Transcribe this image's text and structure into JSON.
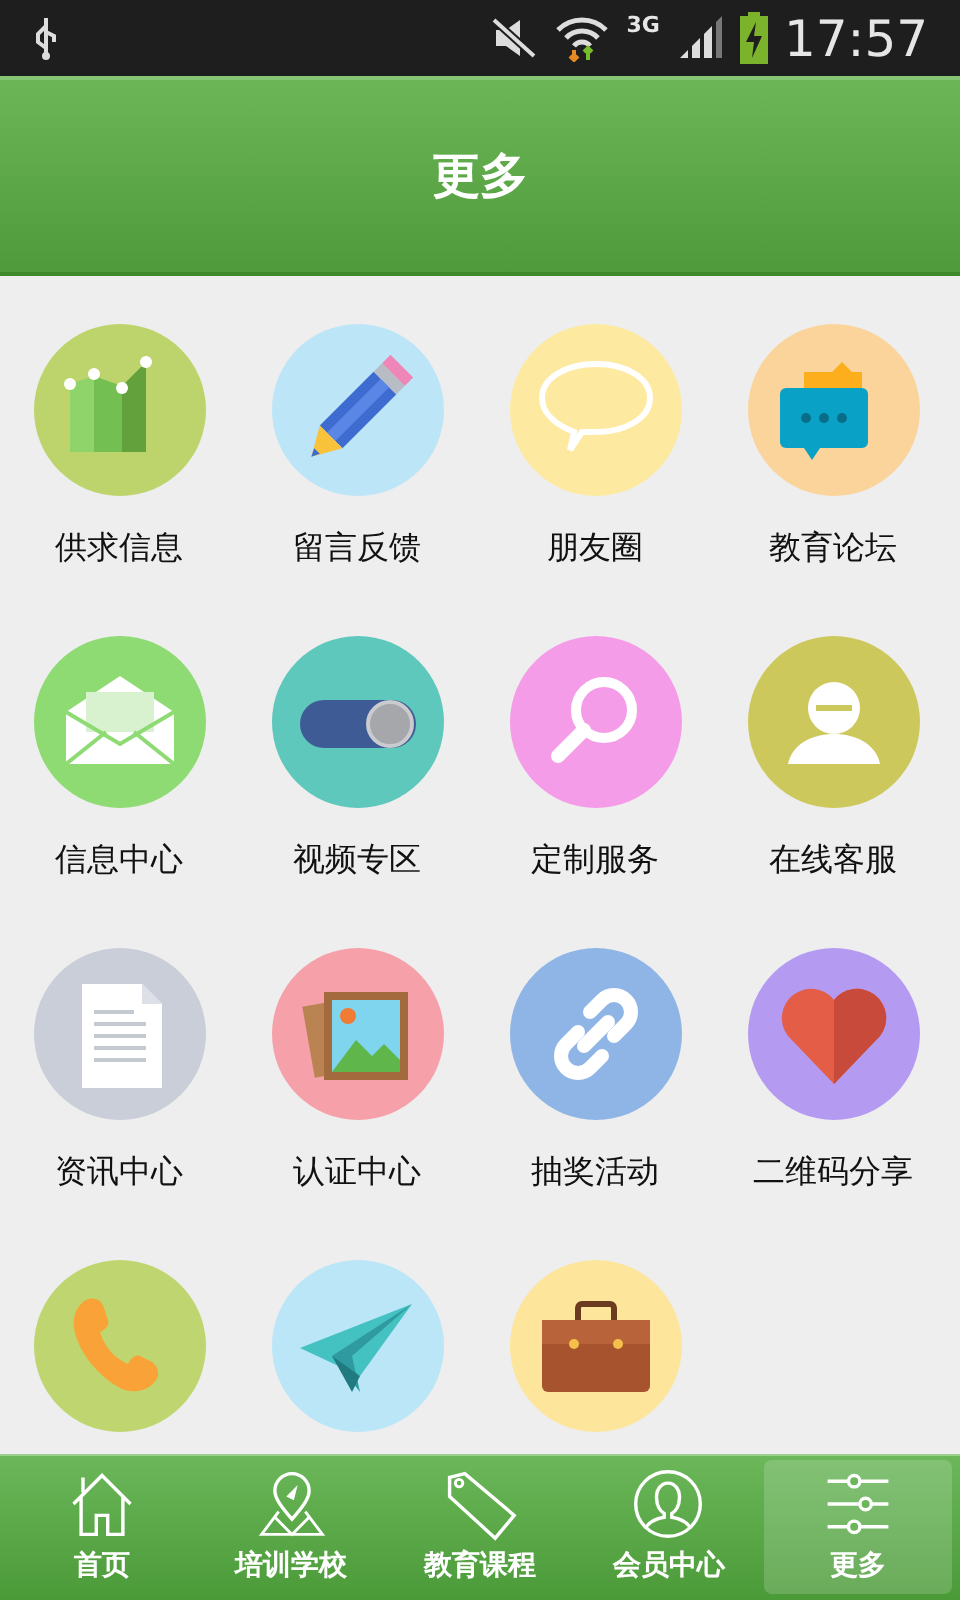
{
  "status_bar": {
    "network": "3G",
    "time": "17:57"
  },
  "header": {
    "title": "更多"
  },
  "grid": [
    {
      "kind": "chart",
      "label": "供求信息"
    },
    {
      "kind": "pencil",
      "label": "留言反馈"
    },
    {
      "kind": "speech",
      "label": "朋友圈"
    },
    {
      "kind": "chat",
      "label": "教育论坛"
    },
    {
      "kind": "envelope",
      "label": "信息中心"
    },
    {
      "kind": "toggle",
      "label": "视频专区"
    },
    {
      "kind": "search",
      "label": "定制服务"
    },
    {
      "kind": "user",
      "label": "在线客服"
    },
    {
      "kind": "document",
      "label": "资讯中心"
    },
    {
      "kind": "frame",
      "label": "认证中心"
    },
    {
      "kind": "link",
      "label": "抽奖活动"
    },
    {
      "kind": "heart",
      "label": "二维码分享"
    },
    {
      "kind": "phone"
    },
    {
      "kind": "plane"
    },
    {
      "kind": "briefcase"
    }
  ],
  "nav": [
    {
      "label": "首页",
      "selected": false
    },
    {
      "label": "培训学校",
      "selected": false
    },
    {
      "label": "教育课程",
      "selected": false
    },
    {
      "label": "会员中心",
      "selected": false
    },
    {
      "label": "更多",
      "selected": true
    }
  ]
}
